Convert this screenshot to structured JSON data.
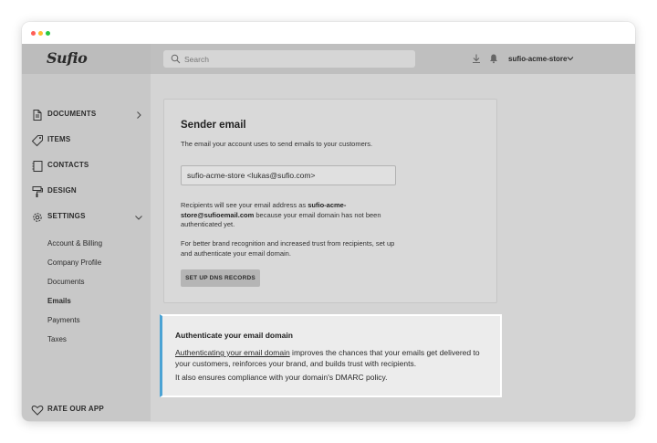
{
  "app": {
    "logo_text": "Sufio"
  },
  "topbar": {
    "search_placeholder": "Search",
    "store_name": "sufio-acme-store"
  },
  "sidebar": {
    "items": [
      {
        "label": "DOCUMENTS",
        "icon": "document-icon",
        "has_chevron": "right"
      },
      {
        "label": "ITEMS",
        "icon": "tag-icon"
      },
      {
        "label": "CONTACTS",
        "icon": "contacts-icon"
      },
      {
        "label": "DESIGN",
        "icon": "paint-roller-icon"
      },
      {
        "label": "SETTINGS",
        "icon": "gear-icon",
        "has_chevron": "down"
      }
    ],
    "settings_subitems": [
      {
        "label": "Account & Billing"
      },
      {
        "label": "Company Profile"
      },
      {
        "label": "Documents"
      },
      {
        "label": "Emails",
        "active": true
      },
      {
        "label": "Payments"
      },
      {
        "label": "Taxes"
      }
    ],
    "footer_label": "RATE OUR APP"
  },
  "sender_email": {
    "title": "Sender email",
    "description": "The email your account uses to send emails to your customers.",
    "input_value": "sufio-acme-store <lukas@sufio.com>",
    "para1_pre": "Recipients will see your email address as ",
    "para1_bold": "sufio-acme-store@sufioemail.com",
    "para1_post": " because your email domain has not been authenticated yet.",
    "para2": "For better brand recognition and increased trust from recipients, set up and authenticate your email domain.",
    "button_label": "SET UP DNS RECORDS"
  },
  "callout": {
    "title": "Authenticate your email domain",
    "link_text": "Authenticating your email domain",
    "body_rest": " improves the chances that your emails get delivered to your customers, reinforces your brand, and builds trust with recipients.",
    "body2": "It also ensures compliance with your domain's DMARC policy."
  },
  "colors": {
    "callout_accent": "#4ba3d4",
    "sidebar_bg": "#c8c8c8",
    "main_bg": "#d4d4d4"
  }
}
